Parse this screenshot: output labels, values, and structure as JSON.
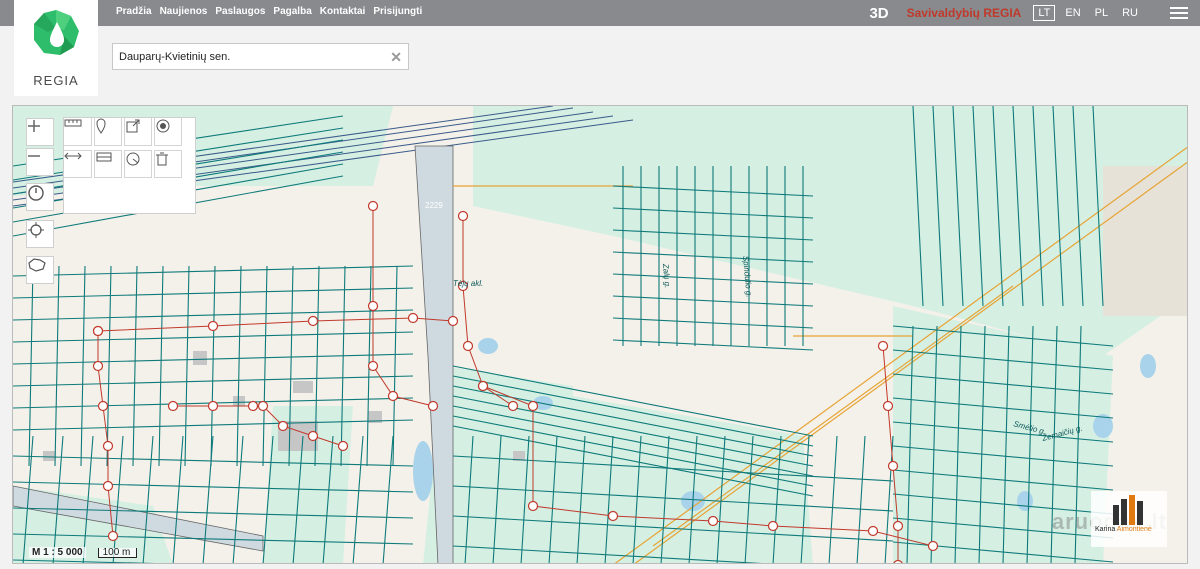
{
  "nav": [
    "Pradžia",
    "Naujienos",
    "Paslaugos",
    "Pagalba",
    "Kontaktai",
    "Prisijungti"
  ],
  "header": {
    "btn3d": "3D",
    "brand": "Savivaldybių REGIA",
    "languages": [
      "LT",
      "EN",
      "PL",
      "RU"
    ],
    "active_language": "LT"
  },
  "logo": {
    "text": "REGIA"
  },
  "search": {
    "value": "Dauparų-Kvietinių sen."
  },
  "map": {
    "street_labels": [
      "Tėjų akl.",
      "Zalų g.",
      "Smėlio g.",
      "Žemaičių g.",
      "Spindulio g."
    ],
    "road_badge": "2229"
  },
  "scale": {
    "ratio": "M 1 : 5 000",
    "bar": "100 m"
  },
  "watermark": {
    "site": "aruodas.lt",
    "name_first": "Karina",
    "name_last": "Aimontienė"
  },
  "colors": {
    "topbar": "#888a8d",
    "brand": "#c0392b",
    "parcel": "#0e7a7a",
    "green": "#d5efe3",
    "road": "#cfd9e0",
    "network": "#c0392b"
  }
}
